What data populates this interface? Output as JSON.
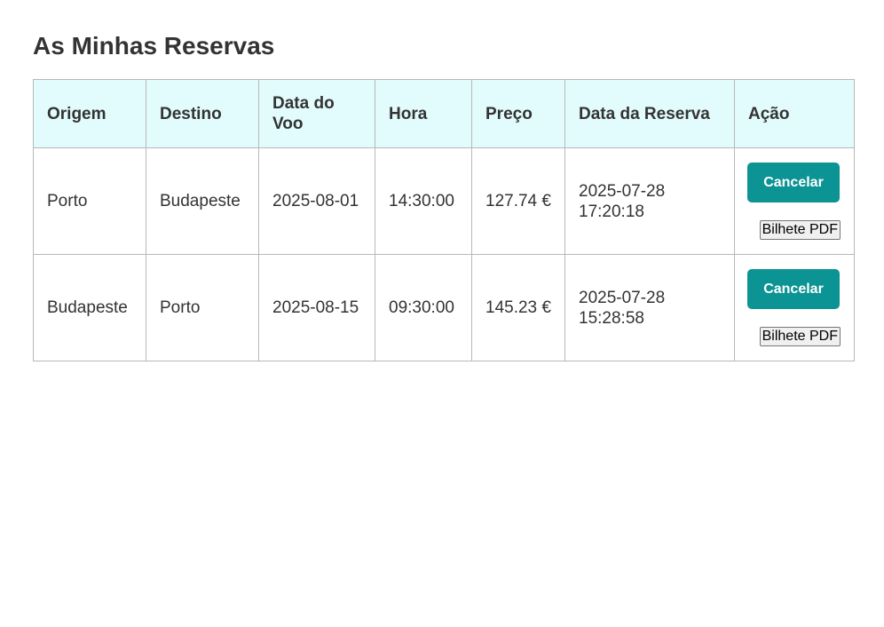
{
  "page": {
    "title": "As Minhas Reservas"
  },
  "table": {
    "headers": {
      "origem": "Origem",
      "destino": "Destino",
      "data_voo": "Data do Voo",
      "hora": "Hora",
      "preco": "Preço",
      "data_reserva": "Data da Reserva",
      "acao": "Ação"
    },
    "rows": [
      {
        "origem": "Porto",
        "destino": "Budapeste",
        "data_voo": "2025-08-01",
        "hora": "14:30:00",
        "preco": "127.74 €",
        "data_reserva": "2025-07-28 17:20:18",
        "cancel_label": "Cancelar",
        "pdf_label": "Bilhete PDF"
      },
      {
        "origem": "Budapeste",
        "destino": "Porto",
        "data_voo": "2025-08-15",
        "hora": "09:30:00",
        "preco": "145.23 €",
        "data_reserva": "2025-07-28 15:28:58",
        "cancel_label": "Cancelar",
        "pdf_label": "Bilhete PDF"
      }
    ]
  },
  "colors": {
    "header_background": "#e2fbfc",
    "cancel_button": "#0c9393",
    "border": "#b8b8b8"
  }
}
